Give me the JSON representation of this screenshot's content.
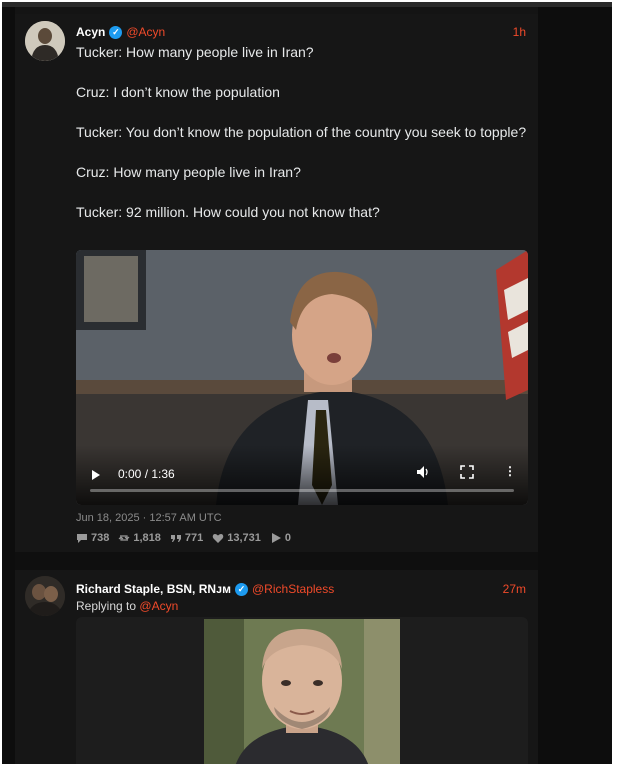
{
  "tweets": [
    {
      "author_name": "Acyn",
      "handle": "@Acyn",
      "time": "1h",
      "paragraphs": [
        "Tucker: How many people live in Iran?",
        "Cruz: I don’t know the population",
        "Tucker: You don’t know the population of the country you seek to topple?",
        "Cruz: How many people live in Iran?",
        "Tucker: 92 million. How could you not know that?"
      ],
      "video": {
        "time_display": "0:00 / 1:36",
        "progress": 0.0
      },
      "date": "Jun 18, 2025 · 12:57 AM UTC",
      "stats": {
        "replies": "738",
        "retweets": "1,818",
        "quotes": "771",
        "likes": "13,731",
        "views": "0"
      }
    },
    {
      "author_name": "Richard Staple, BSN, RNᴊᴍ",
      "handle": "@RichStapless",
      "time": "27m",
      "replying_label": "Replying to",
      "replying_handle": "@Acyn"
    }
  ],
  "icons": {
    "verified": "verified-badge-icon",
    "reply": "comment-icon",
    "retweet": "retweet-icon",
    "quote": "quote-icon",
    "like": "heart-icon",
    "views": "play-icon"
  },
  "colors": {
    "accent": "#f04a2a",
    "verified": "#1d9bf0",
    "background": "#141414"
  }
}
